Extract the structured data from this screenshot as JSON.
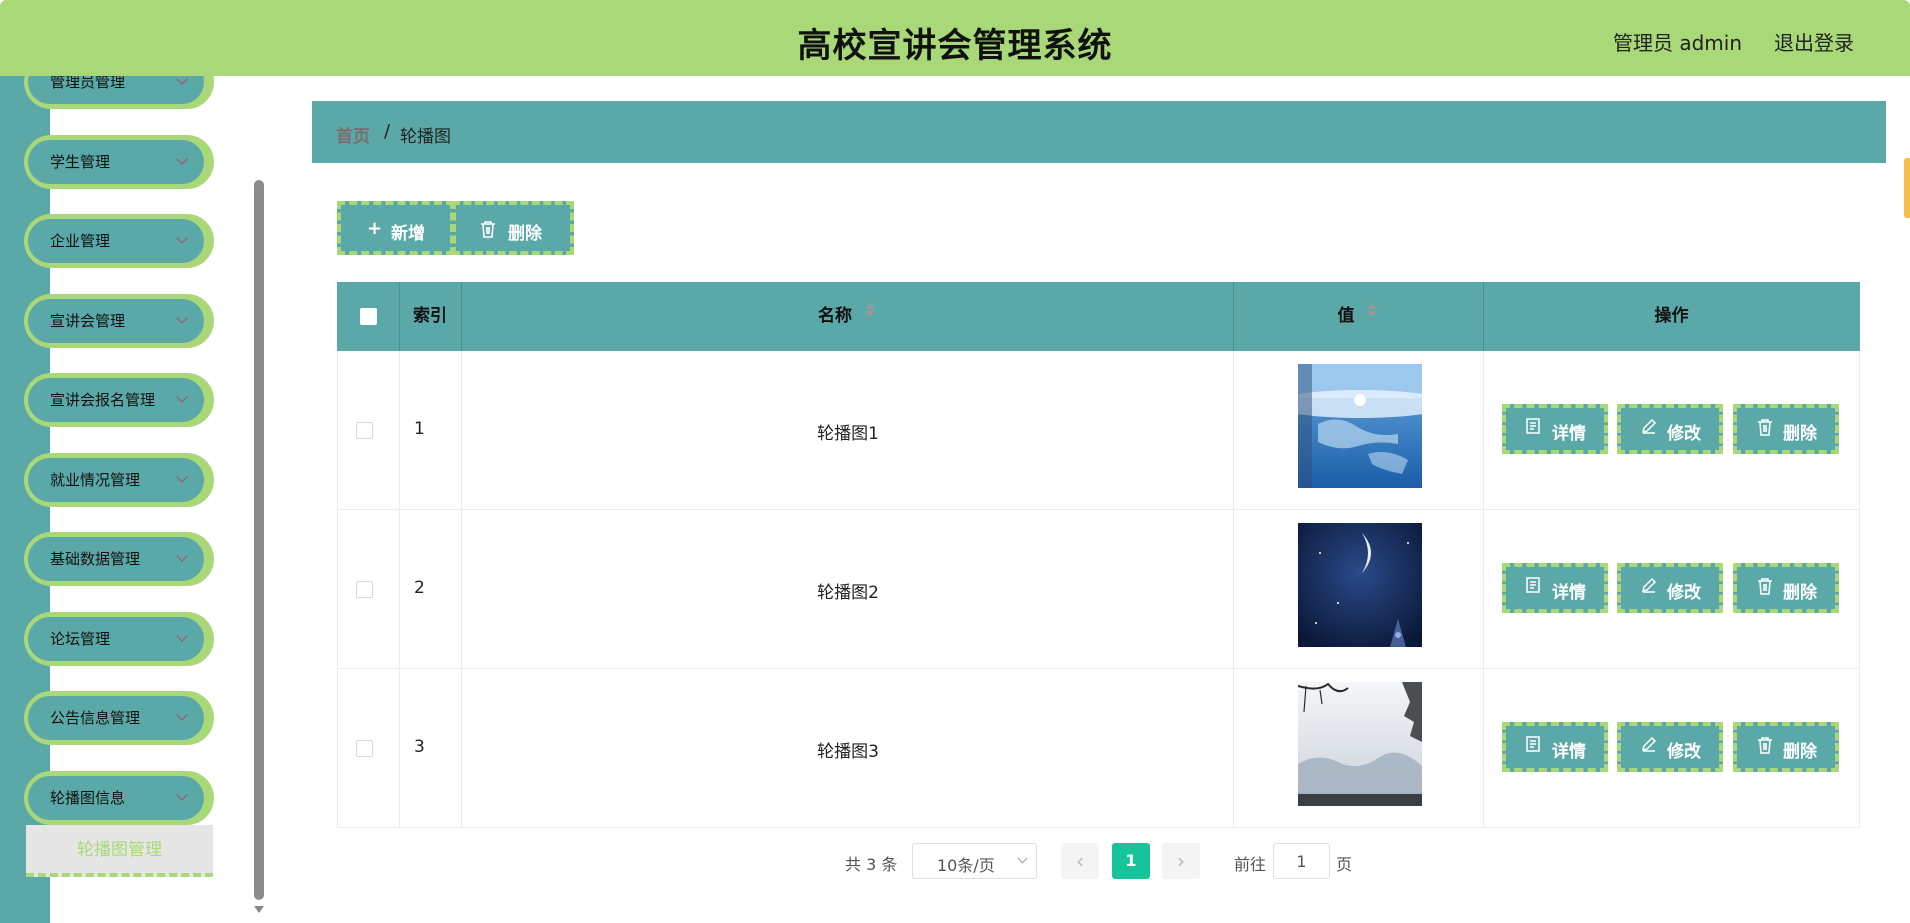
{
  "header": {
    "title": "高校宣讲会管理系统",
    "user": "管理员 admin",
    "logout": "退出登录"
  },
  "sidebar": {
    "items": [
      {
        "label": "管理员管理"
      },
      {
        "label": "学生管理"
      },
      {
        "label": "企业管理"
      },
      {
        "label": "宣讲会管理"
      },
      {
        "label": "宣讲会报名管理"
      },
      {
        "label": "就业情况管理"
      },
      {
        "label": "基础数据管理"
      },
      {
        "label": "论坛管理"
      },
      {
        "label": "公告信息管理"
      },
      {
        "label": "轮播图信息"
      }
    ],
    "submenu": {
      "label": "轮播图管理"
    }
  },
  "breadcrumb": {
    "home": "首页",
    "separator": "/",
    "current": "轮播图"
  },
  "toolbar": {
    "add": "新增",
    "delete": "删除"
  },
  "table": {
    "columns": {
      "index": "索引",
      "name": "名称",
      "value": "值",
      "action": "操作"
    },
    "rows": [
      {
        "index": "1",
        "name": "轮播图1",
        "image": "globe-image"
      },
      {
        "index": "2",
        "name": "轮播图2",
        "image": "night-sky-image"
      },
      {
        "index": "3",
        "name": "轮播图3",
        "image": "landscape-image"
      }
    ],
    "actions": {
      "detail": "详情",
      "edit": "修改",
      "delete": "删除"
    }
  },
  "pagination": {
    "total": "共 3 条",
    "page_size": "10条/页",
    "current_page": "1",
    "goto_label": "前往",
    "goto_value": "1",
    "page_suffix": "页"
  },
  "colors": {
    "accent": "#a8d878",
    "teal": "#5ba8a8",
    "active": "#17c39a"
  }
}
